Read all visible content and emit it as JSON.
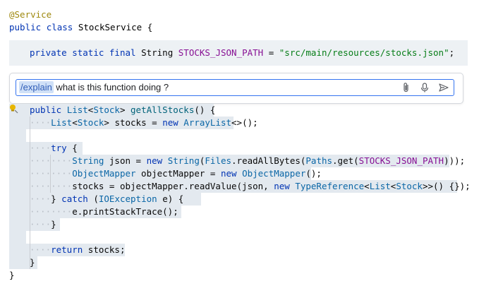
{
  "code": {
    "annotation": "@Service",
    "class_decl": {
      "kw_public": "public",
      "kw_class": "class",
      "name": "StockService",
      "brace": "{"
    },
    "field_decl": {
      "kw_private": "private",
      "kw_static": "static",
      "kw_final": "final",
      "type": "String",
      "name": "STOCKS_JSON_PATH",
      "eq": "=",
      "value": "\"src/main/resources/stocks.json\"",
      "semi": ";"
    },
    "method_lines": [
      "public List<Stock> getAllStocks() {",
      "List<Stock> stocks = new ArrayList<>();",
      "try {",
      "String json = new String(Files.readAllBytes(Paths.get(STOCKS_JSON_PATH)));",
      "ObjectMapper objectMapper = new ObjectMapper();",
      "stocks = objectMapper.readValue(json, new TypeReference<List<Stock>>() {});",
      "} catch (IOException e) {",
      "e.printStackTrace();",
      "}",
      "return stocks;",
      "}",
      "}"
    ]
  },
  "chat": {
    "command": "/explain",
    "query": " what is this function doing ?",
    "icons": [
      "paperclip-icon",
      "microphone-icon",
      "send-icon"
    ]
  },
  "colors": {
    "keyword": "#0033b3",
    "string": "#067d17",
    "annotation": "#9e880d",
    "selection": "#e3e9ef",
    "input_border": "#3574f0"
  }
}
